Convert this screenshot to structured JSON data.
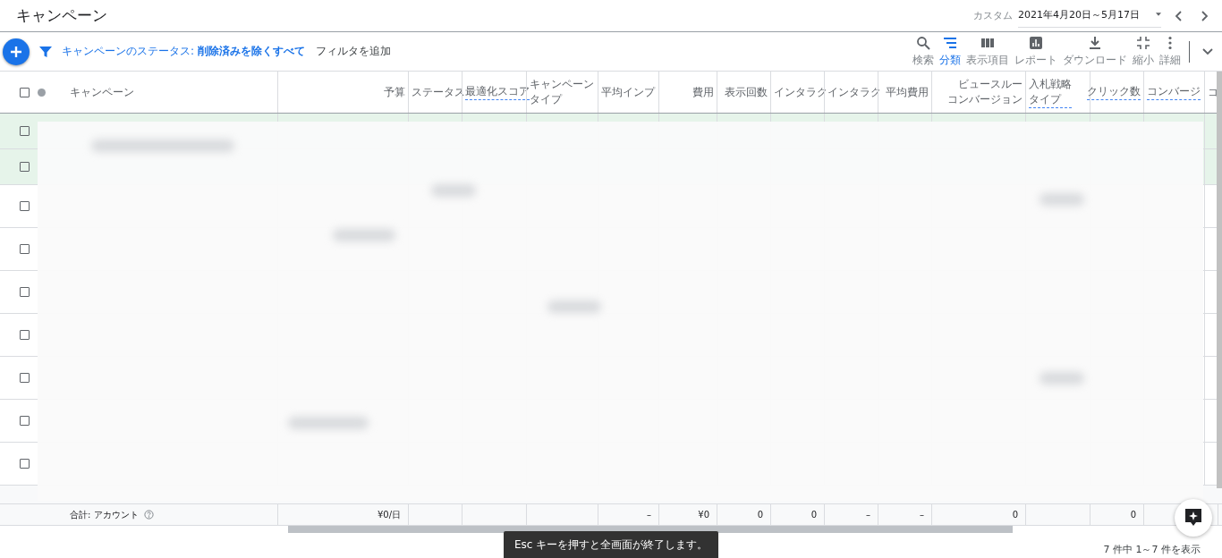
{
  "header": {
    "title": "キャンペーン",
    "date_preset": "カスタム",
    "date_range": "2021年4月20日～5月17日"
  },
  "filter_bar": {
    "filter_label": "キャンペーンのステータス:",
    "filter_value": "削除済みを除くすべて",
    "add_filter": "フィルタを追加"
  },
  "toolbar": [
    {
      "kind": "search",
      "label": "検索",
      "selected": false
    },
    {
      "kind": "segment",
      "label": "分類",
      "selected": true
    },
    {
      "kind": "columns",
      "label": "表示項目",
      "selected": false
    },
    {
      "kind": "reports",
      "label": "レポート",
      "selected": false
    },
    {
      "kind": "download",
      "label": "ダウンロード",
      "selected": false
    },
    {
      "kind": "collapse",
      "label": "縮小",
      "selected": false
    },
    {
      "kind": "more",
      "label": "詳細",
      "selected": false
    }
  ],
  "table": {
    "columns": [
      {
        "lines": [
          "キャンペーン"
        ],
        "underlined": false
      },
      {
        "lines": [
          "予算"
        ],
        "underlined": false,
        "total": "¥0/日"
      },
      {
        "lines": [
          "ステータス"
        ],
        "underlined": false
      },
      {
        "lines": [
          "最適化スコア"
        ],
        "underlined": true
      },
      {
        "lines": [
          "キャンペーン",
          "タイプ"
        ],
        "underlined": false
      },
      {
        "lines": [
          "平均インプ"
        ],
        "underlined": false,
        "total": "–"
      },
      {
        "lines": [
          "費用"
        ],
        "underlined": false,
        "total": "¥0"
      },
      {
        "lines": [
          "表示回数"
        ],
        "underlined": false,
        "total": "0"
      },
      {
        "lines": [
          "インタラク"
        ],
        "underlined": false,
        "total": "0"
      },
      {
        "lines": [
          "インタラク"
        ],
        "underlined": false,
        "total": "–"
      },
      {
        "lines": [
          "平均費用"
        ],
        "underlined": false,
        "total": "–"
      },
      {
        "lines": [
          "ビュースルー",
          "コンバージョン"
        ],
        "underlined": false,
        "total": "0"
      },
      {
        "lines": [
          "入札戦略",
          "タイプ"
        ],
        "underlined": true
      },
      {
        "lines": [
          "クリック数"
        ],
        "underlined": true,
        "total": "0"
      },
      {
        "lines": [
          "コンバージ"
        ],
        "underlined": true
      },
      {
        "lines": [
          "コ"
        ],
        "underlined": false
      }
    ],
    "select_all_checked": false,
    "rows": [
      {
        "selected": true,
        "checked": false
      },
      {
        "selected": true,
        "checked": false
      },
      {
        "selected": false,
        "checked": false
      },
      {
        "selected": false,
        "checked": false
      },
      {
        "selected": false,
        "checked": false
      },
      {
        "selected": false,
        "checked": false
      },
      {
        "selected": false,
        "checked": false
      },
      {
        "selected": false,
        "checked": false
      },
      {
        "selected": false,
        "checked": false
      }
    ],
    "total_label": "合計: アカウント"
  },
  "footer": {
    "pagination": "7 件中 1～7 件を表示"
  },
  "toast": "Esc キーを押すと全画面が終了します。"
}
